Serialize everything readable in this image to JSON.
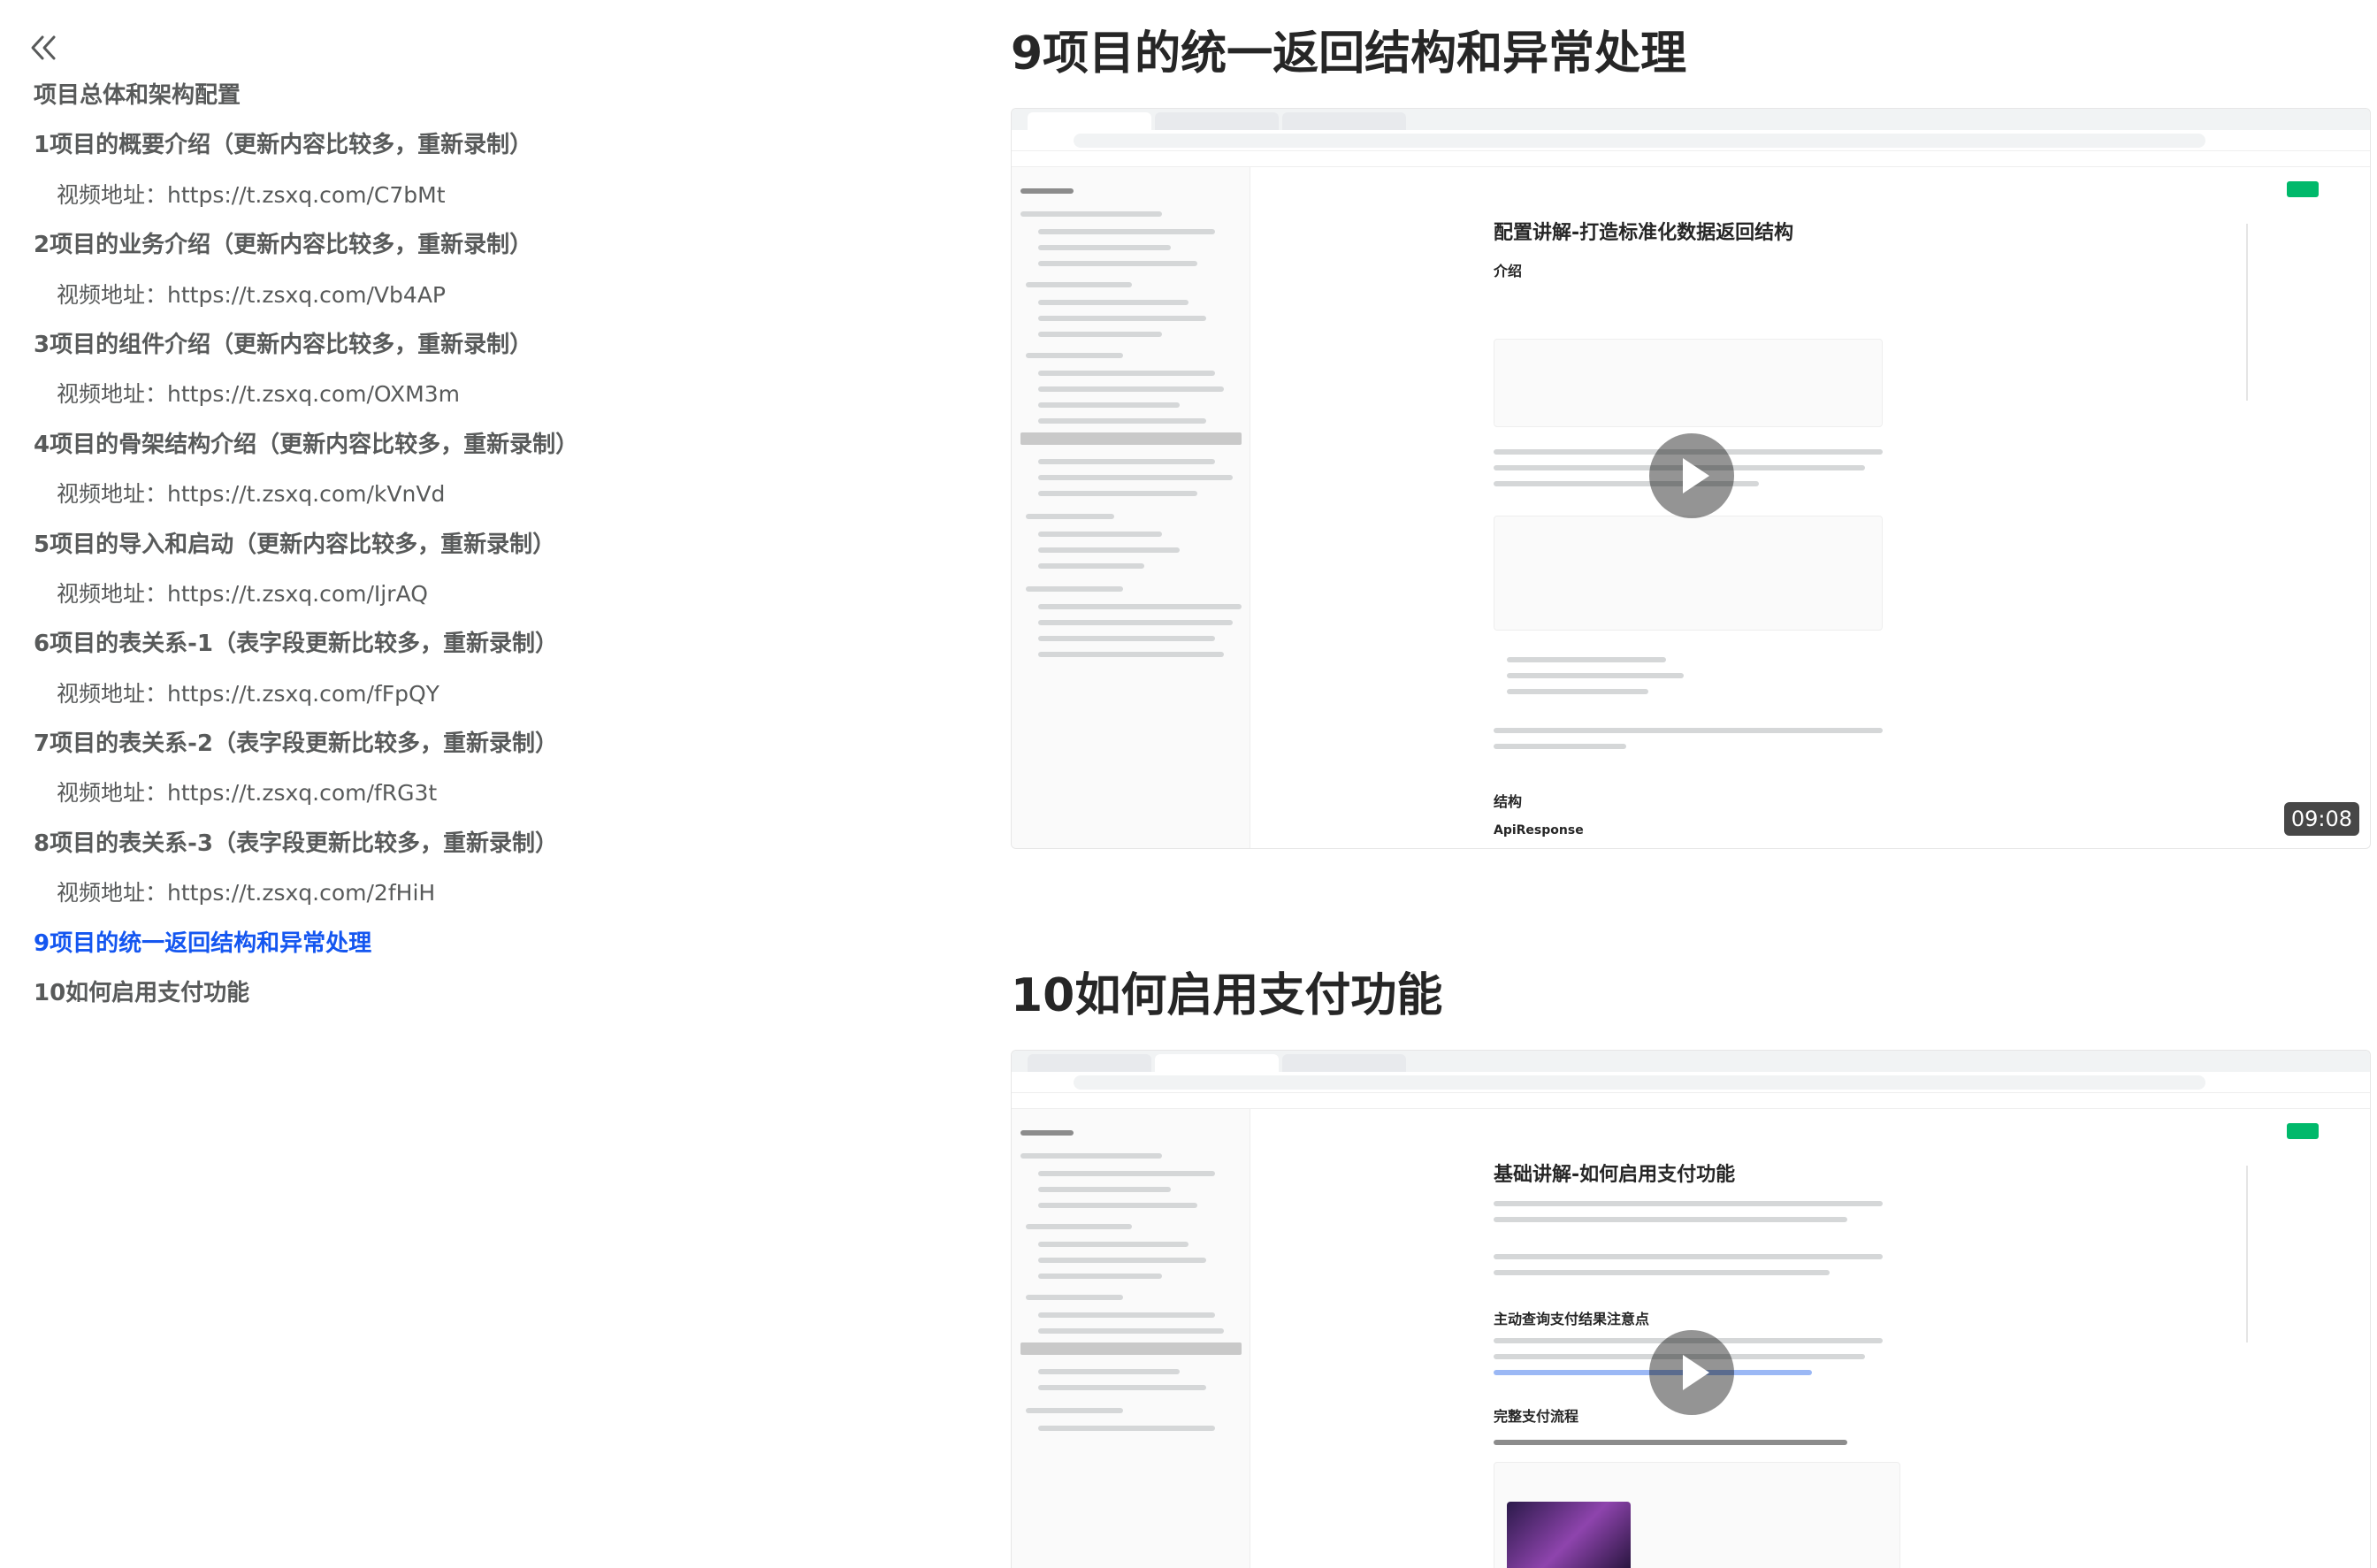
{
  "toc": {
    "collapse_icon": "double-chevron-left-icon",
    "items": [
      {
        "type": "h",
        "label": "项目总体和架构配置",
        "active": false
      },
      {
        "type": "h",
        "label": "1项目的概要介绍（更新内容比较多，重新录制）",
        "active": false
      },
      {
        "type": "sub",
        "label": "视频地址：https://t.zsxq.com/C7bMt"
      },
      {
        "type": "h",
        "label": "2项目的业务介绍（更新内容比较多，重新录制）",
        "active": false
      },
      {
        "type": "sub",
        "label": "视频地址：https://t.zsxq.com/Vb4AP"
      },
      {
        "type": "h",
        "label": "3项目的组件介绍（更新内容比较多，重新录制）",
        "active": false
      },
      {
        "type": "sub",
        "label": "视频地址：https://t.zsxq.com/OXM3m"
      },
      {
        "type": "h",
        "label": "4项目的骨架结构介绍（更新内容比较多，重新录制）",
        "active": false
      },
      {
        "type": "sub",
        "label": "视频地址：https://t.zsxq.com/kVnVd"
      },
      {
        "type": "h",
        "label": "5项目的导入和启动（更新内容比较多，重新录制）",
        "active": false
      },
      {
        "type": "sub",
        "label": "视频地址：https://t.zsxq.com/IjrAQ"
      },
      {
        "type": "h",
        "label": "6项目的表关系-1（表字段更新比较多，重新录制）",
        "active": false
      },
      {
        "type": "sub",
        "label": "视频地址：https://t.zsxq.com/fFpQY"
      },
      {
        "type": "h",
        "label": "7项目的表关系-2（表字段更新比较多，重新录制）",
        "active": false
      },
      {
        "type": "sub",
        "label": "视频地址：https://t.zsxq.com/fRG3t"
      },
      {
        "type": "h",
        "label": "8项目的表关系-3（表字段更新比较多，重新录制）",
        "active": false
      },
      {
        "type": "sub",
        "label": "视频地址：https://t.zsxq.com/2fHiH"
      },
      {
        "type": "h",
        "label": "9项目的统一返回结构和异常处理",
        "active": true
      },
      {
        "type": "h",
        "label": "10如何启用支付功能",
        "active": false
      }
    ]
  },
  "main": {
    "sections": [
      {
        "title": "9项目的统一返回结构和异常处理",
        "video": {
          "duration": "09:08",
          "doc_title": "配置讲解-打造标准化数据返回结构",
          "doc_h2_a": "介绍",
          "doc_h2_b": "结构",
          "doc_h2_c": "ApiResponse"
        }
      },
      {
        "title": "10如何启用支付功能",
        "video": {
          "duration": "",
          "doc_title": "基础讲解-如何启用支付功能",
          "doc_h2_a": "主动查询支付结果注意点",
          "doc_h2_b": "完整支付流程",
          "doc_h2_c": ""
        }
      }
    ]
  },
  "colors": {
    "active_link": "#1456f0",
    "toc_text": "#585a5a",
    "title_text": "#262626",
    "brand_green": "#00b96b"
  }
}
